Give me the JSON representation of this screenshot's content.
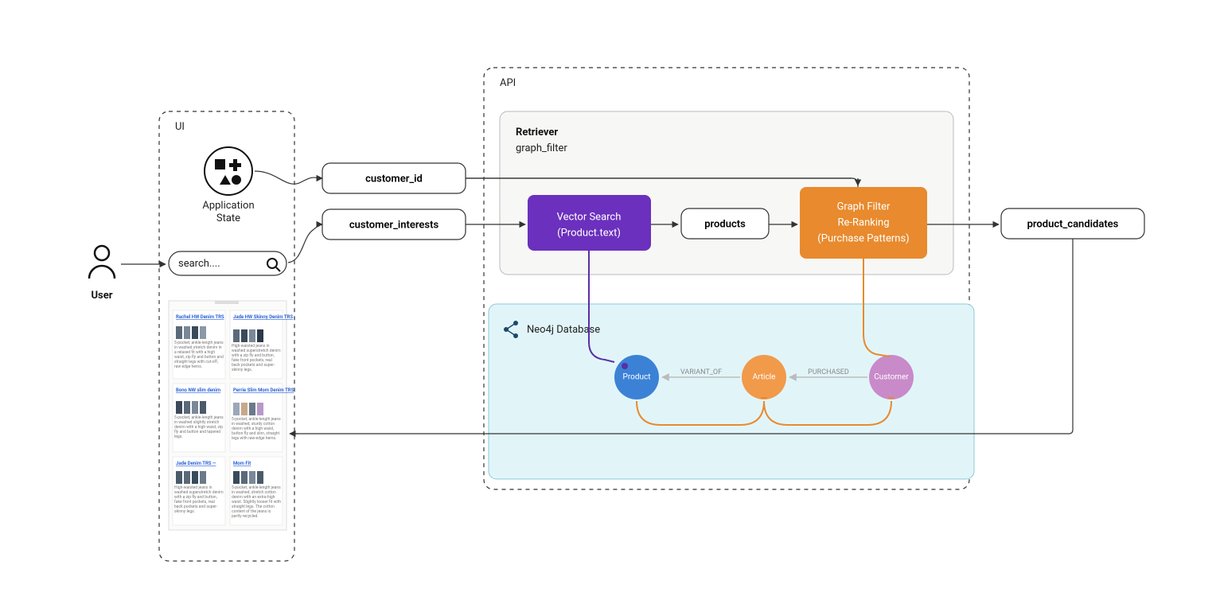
{
  "user_label": "User",
  "ui_section_label": "UI",
  "api_section_label": "API",
  "application_state_label_1": "Application",
  "application_state_label_2": "State",
  "search_placeholder": "search....",
  "customer_id_label": "customer_id",
  "customer_interests_label": "customer_interests",
  "retriever_title": "Retriever",
  "retriever_subtitle": "graph_filter",
  "vector_search_line1": "Vector Search",
  "vector_search_line2": "(Product.text)",
  "products_label": "products",
  "graph_filter_line1": "Graph Filter",
  "graph_filter_line2": "Re-Ranking",
  "graph_filter_line3": "(Purchase Patterns)",
  "product_candidates_label": "product_candidates",
  "neo4j_label": "Neo4j Database",
  "node_product": "Product",
  "node_article": "Article",
  "node_customer": "Customer",
  "rel_variant_of": "VARIANT_OF",
  "rel_purchased": "PURCHASED",
  "results": {
    "col1": [
      {
        "title": "Rachel HW Denim TRS",
        "desc": "5-pocket, ankle-length jeans in washed stretch denim in a relaxed fit with a high waist, zip fly and button and straight legs with cut-off, raw edge hems."
      },
      {
        "title": "Bono NW slim denim",
        "desc": "5-pocket, ankle-length jeans in washed slightly stretch denim with a high waist, zip fly and button and tapered legs."
      },
      {
        "title": "Jade Denim TRS —",
        "desc": "High-waisted jeans in washed superstretch denim with a zip fly and button, fake front pockets, real back pockets and super-skinny legs."
      }
    ],
    "col2": [
      {
        "title": "Jade HW Skinny Denim TRS",
        "desc": "High-waisted jeans in washed superstretch denim with a zip fly and button, fake front pockets, real back pockets and super-skinny legs."
      },
      {
        "title": "Perrie Slim Mom Denim TRS",
        "desc": "5-pocket, ankle-length jeans in washed, sturdy cotton denim with a high waist, button fly and slim, straight legs with raw-edge hems."
      },
      {
        "title": "Mom Fit",
        "desc": "5-pocket, ankle-length jeans in washed, stretch cotton denim with an extra-high waist. Slightly looser fit with straight legs. The cotton content of the jeans is partly recycled."
      }
    ]
  }
}
